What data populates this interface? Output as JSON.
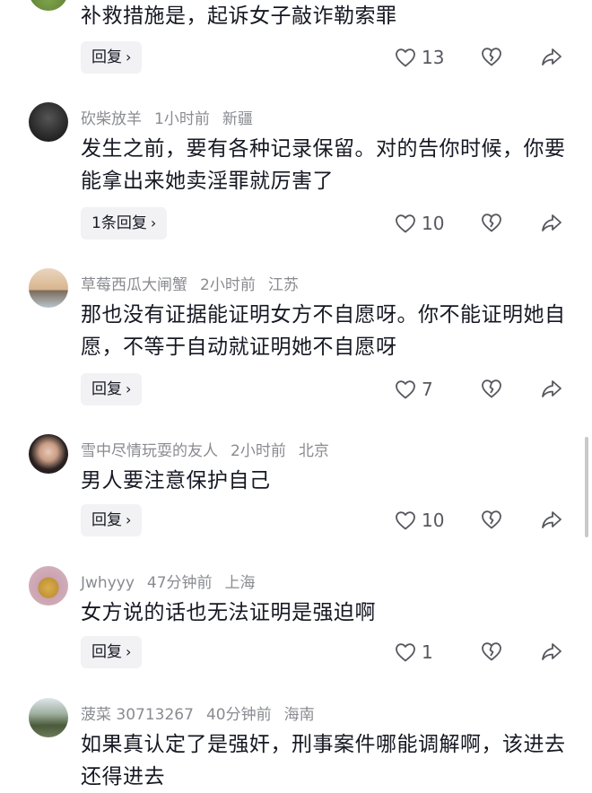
{
  "top_partial": {
    "text": "补救措施是，起诉女子敲诈勒索罪",
    "reply_label": "回复",
    "likes": "13"
  },
  "comments": [
    {
      "user": "砍柴放羊",
      "time": "1小时前",
      "location": "新疆",
      "text": "发生之前，要有各种记录保留。对的告你时候，你要能拿出来她卖淫罪就厉害了",
      "reply_label": "1条回复",
      "likes": "10"
    },
    {
      "user": "草莓西瓜大闸蟹",
      "time": "2小时前",
      "location": "江苏",
      "text": "那也没有证据能证明女方不自愿呀。你不能证明她自愿，不等于自动就证明她不自愿呀",
      "reply_label": "回复",
      "likes": "7"
    },
    {
      "user": "雪中尽情玩耍的友人",
      "time": "2小时前",
      "location": "北京",
      "text": "男人要注意保护自己",
      "reply_label": "回复",
      "likes": "10"
    },
    {
      "user": "Jwhyyy",
      "time": "47分钟前",
      "location": "上海",
      "text": "女方说的话也无法证明是强迫啊",
      "reply_label": "回复",
      "likes": "1"
    },
    {
      "user": "菠菜 30713267",
      "time": "40分钟前",
      "location": "海南",
      "text": "如果真认定了是强奸，刑事案件哪能调解啊，该进去还得进去"
    }
  ],
  "icons": {
    "like": "heart-outline-icon",
    "dislike": "broken-heart-icon",
    "share": "share-arrow-icon",
    "reply_chevron": "chevron-right-icon"
  },
  "colors": {
    "text": "#161823",
    "meta": "#8a8b91",
    "button_bg": "#f2f2f4"
  }
}
